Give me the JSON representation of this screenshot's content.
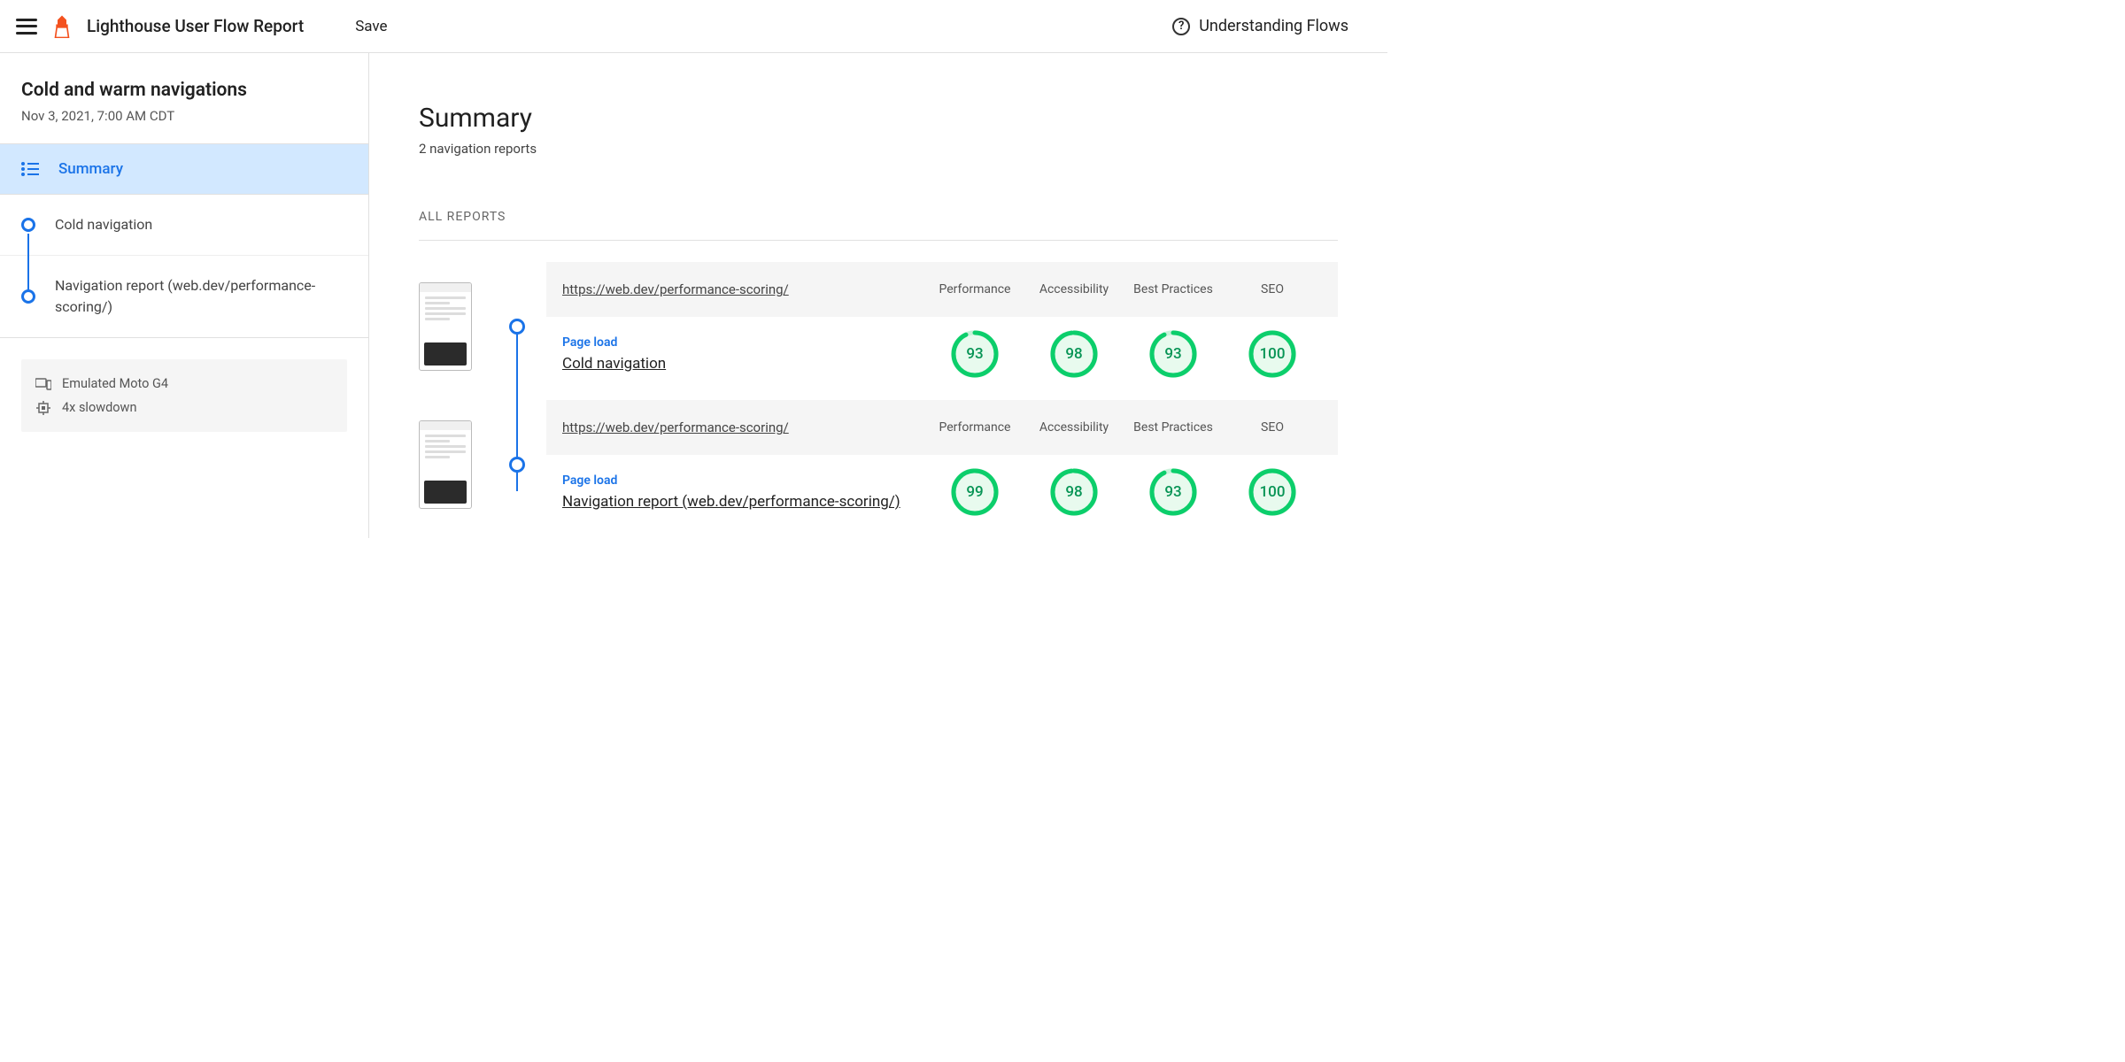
{
  "topbar": {
    "title": "Lighthouse User Flow Report",
    "save": "Save",
    "help": "Understanding Flows"
  },
  "sidebar": {
    "title": "Cold and warm navigations",
    "date": "Nov 3, 2021, 7:00 AM CDT",
    "summary": "Summary",
    "items": [
      {
        "label": "Cold navigation"
      },
      {
        "label": "Navigation report (web.dev/performance-scoring/)"
      }
    ],
    "env": {
      "device": "Emulated Moto G4",
      "throttle": "4x slowdown"
    }
  },
  "main": {
    "title": "Summary",
    "subtitle": "2 navigation reports",
    "all_reports": "ALL REPORTS",
    "columns": [
      "Performance",
      "Accessibility",
      "Best Practices",
      "SEO"
    ],
    "reports": [
      {
        "url": "https://web.dev/performance-scoring/",
        "type_label": "Page load",
        "name": "Cold navigation",
        "scores": [
          93,
          98,
          93,
          100
        ]
      },
      {
        "url": "https://web.dev/performance-scoring/",
        "type_label": "Page load",
        "name": "Navigation report (web.dev/performance-scoring/)",
        "scores": [
          99,
          98,
          93,
          100
        ]
      }
    ]
  },
  "colors": {
    "accent": "#1a73e8",
    "good": "#0cce6b"
  }
}
